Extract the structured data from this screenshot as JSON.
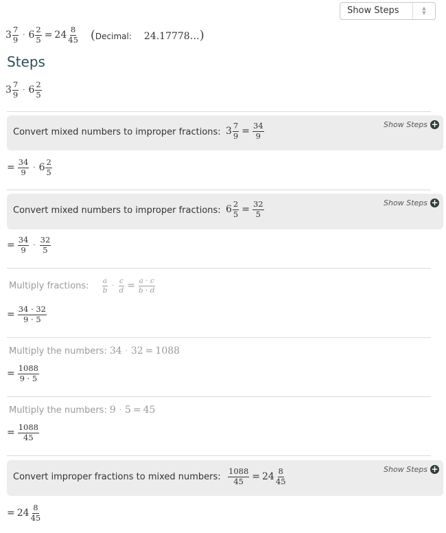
{
  "dropdown": {
    "selected": "Show Steps"
  },
  "answer": {
    "lhs1": {
      "whole": "3",
      "num": "7",
      "den": "9"
    },
    "lhs2": {
      "whole": "6",
      "num": "2",
      "den": "5"
    },
    "rhs": {
      "whole": "24",
      "num": "8",
      "den": "45"
    },
    "decimal_label": "Decimal:",
    "decimal_value": "24.17778…"
  },
  "steps_heading": "Steps",
  "steps": [
    {
      "description": "Convert mixed numbers to improper fractions:",
      "show_steps": "Show Steps",
      "math": {
        "whole": "3",
        "num": "7",
        "den": "9",
        "res_num": "34",
        "res_den": "9"
      },
      "result": {
        "f1_num": "34",
        "f1_den": "9",
        "m_whole": "6",
        "m_num": "2",
        "m_den": "5"
      }
    },
    {
      "description": "Convert mixed numbers to improper fractions:",
      "show_steps": "Show Steps",
      "math": {
        "whole": "6",
        "num": "2",
        "den": "5",
        "res_num": "32",
        "res_den": "5"
      },
      "result": {
        "f1_num": "34",
        "f1_den": "9",
        "f2_num": "32",
        "f2_den": "5"
      }
    },
    {
      "description": "Multiply fractions:",
      "rule": {
        "a": "a",
        "b": "b",
        "c": "c",
        "d": "d"
      },
      "result": {
        "num": "34 · 32",
        "den": "9 · 5"
      }
    },
    {
      "description": "Multiply the numbers:",
      "math": {
        "x": "34",
        "y": "32",
        "z": "1088"
      },
      "result": {
        "num": "1088",
        "den": "9 · 5"
      }
    },
    {
      "description": "Multiply the numbers:",
      "math": {
        "x": "9",
        "y": "5",
        "z": "45"
      },
      "result": {
        "num": "1088",
        "den": "45"
      }
    },
    {
      "description": "Convert improper fractions to mixed numbers:",
      "show_steps": "Show Steps",
      "math": {
        "num": "1088",
        "den": "45",
        "whole": "24",
        "res_num": "8",
        "res_den": "45"
      },
      "result": {
        "whole": "24",
        "num": "8",
        "den": "45"
      }
    }
  ],
  "symbols": {
    "times": "·",
    "equals": "="
  }
}
